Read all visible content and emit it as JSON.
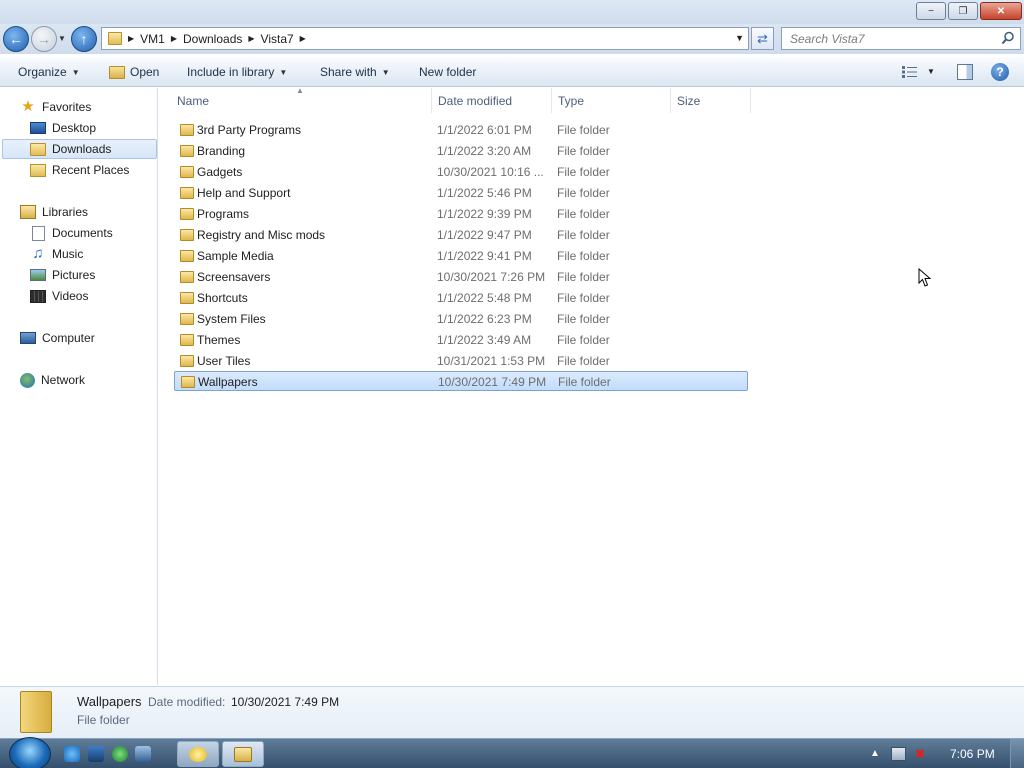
{
  "window": {
    "minimize_glyph": "−",
    "restore_glyph": "❐",
    "close_glyph": "✕"
  },
  "address": {
    "crumbs": [
      "VM1",
      "Downloads",
      "Vista7"
    ]
  },
  "search": {
    "placeholder": "Search Vista7"
  },
  "commands": {
    "organize": "Organize",
    "open": "Open",
    "include_in_library": "Include in library",
    "share_with": "Share with",
    "new_folder": "New folder"
  },
  "nav": {
    "favorites": "Favorites",
    "desktop": "Desktop",
    "downloads": "Downloads",
    "recent_places": "Recent Places",
    "libraries": "Libraries",
    "documents": "Documents",
    "music": "Music",
    "pictures": "Pictures",
    "videos": "Videos",
    "computer": "Computer",
    "network": "Network"
  },
  "columns": {
    "name": "Name",
    "date_modified": "Date modified",
    "type": "Type",
    "size": "Size"
  },
  "files": [
    {
      "name": "3rd Party Programs",
      "date": "1/1/2022 6:01 PM",
      "type": "File folder"
    },
    {
      "name": "Branding",
      "date": "1/1/2022 3:20 AM",
      "type": "File folder"
    },
    {
      "name": "Gadgets",
      "date": "10/30/2021 10:16 ...",
      "type": "File folder"
    },
    {
      "name": "Help and Support",
      "date": "1/1/2022 5:46 PM",
      "type": "File folder"
    },
    {
      "name": "Programs",
      "date": "1/1/2022 9:39 PM",
      "type": "File folder"
    },
    {
      "name": "Registry and Misc mods",
      "date": "1/1/2022 9:47 PM",
      "type": "File folder"
    },
    {
      "name": "Sample Media",
      "date": "1/1/2022 9:41 PM",
      "type": "File folder"
    },
    {
      "name": "Screensavers",
      "date": "10/30/2021 7:26 PM",
      "type": "File folder"
    },
    {
      "name": "Shortcuts",
      "date": "1/1/2022 5:48 PM",
      "type": "File folder"
    },
    {
      "name": "System Files",
      "date": "1/1/2022 6:23 PM",
      "type": "File folder"
    },
    {
      "name": "Themes",
      "date": "1/1/2022 3:49 AM",
      "type": "File folder"
    },
    {
      "name": "User Tiles",
      "date": "10/31/2021 1:53 PM",
      "type": "File folder"
    },
    {
      "name": "Wallpapers",
      "date": "10/30/2021 7:49 PM",
      "type": "File folder"
    }
  ],
  "details": {
    "name": "Wallpapers",
    "date_label": "Date modified:",
    "date_value": "10/30/2021 7:49 PM",
    "type": "File folder"
  },
  "taskbar": {
    "clock": "7:06 PM"
  },
  "colors": {
    "accent": "#1f5fae",
    "selection": "#c1dcfc"
  }
}
